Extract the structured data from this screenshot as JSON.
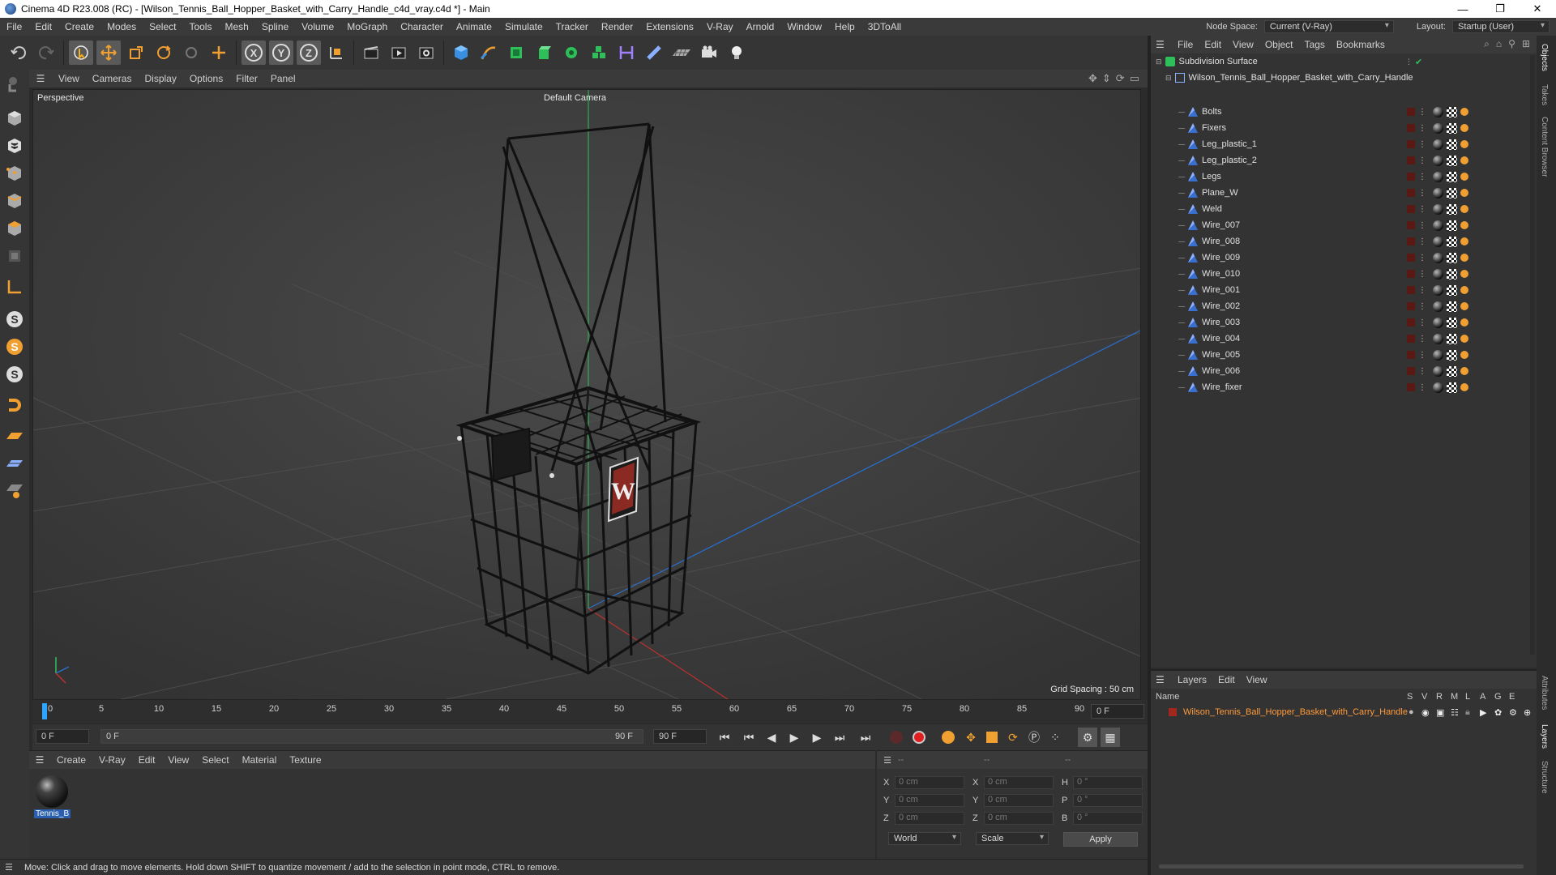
{
  "window": {
    "title": "Cinema 4D R23.008 (RC) - [Wilson_Tennis_Ball_Hopper_Basket_with_Carry_Handle_c4d_vray.c4d *] - Main",
    "controls": [
      "—",
      "❐",
      "✕"
    ]
  },
  "menubar": {
    "items": [
      "File",
      "Edit",
      "Create",
      "Modes",
      "Select",
      "Tools",
      "Mesh",
      "Spline",
      "Volume",
      "MoGraph",
      "Character",
      "Animate",
      "Simulate",
      "Tracker",
      "Render",
      "Extensions",
      "V-Ray",
      "Arnold",
      "Window",
      "Help",
      "3DToAll"
    ],
    "node_space_label": "Node Space:",
    "node_space_value": "Current (V-Ray)",
    "layout_label": "Layout:",
    "layout_value": "Startup (User)"
  },
  "viewport": {
    "menu": [
      "View",
      "Cameras",
      "Display",
      "Options",
      "Filter",
      "Panel"
    ],
    "projection": "Perspective",
    "camera": "Default Camera",
    "grid_spacing": "Grid Spacing : 50 cm"
  },
  "timeline": {
    "ticks": [
      "0",
      "5",
      "10",
      "15",
      "20",
      "25",
      "30",
      "35",
      "40",
      "45",
      "50",
      "55",
      "60",
      "65",
      "70",
      "75",
      "80",
      "85",
      "90"
    ],
    "current_frame": "0 F",
    "start_field": "0 F",
    "range_start": "0 F",
    "range_end": "90 F",
    "end_field": "90 F"
  },
  "material_manager": {
    "menu": [
      "Create",
      "V-Ray",
      "Edit",
      "View",
      "Select",
      "Material",
      "Texture"
    ],
    "materials": [
      {
        "name": "Tennis_B"
      }
    ]
  },
  "coordinates": {
    "header": [
      "--",
      "--",
      "--"
    ],
    "rows": [
      {
        "a": "X",
        "a_val": "0 cm",
        "b": "X",
        "b_val": "0 cm",
        "c": "H",
        "c_val": "0 °"
      },
      {
        "a": "Y",
        "a_val": "0 cm",
        "b": "Y",
        "b_val": "0 cm",
        "c": "P",
        "c_val": "0 °"
      },
      {
        "a": "Z",
        "a_val": "0 cm",
        "b": "Z",
        "b_val": "0 cm",
        "c": "B",
        "c_val": "0 °"
      }
    ],
    "space": "World",
    "mode": "Scale",
    "apply": "Apply"
  },
  "status": {
    "text": "Move: Click and drag to move elements. Hold down SHIFT to quantize movement / add to the selection in point mode, CTRL to remove."
  },
  "object_manager": {
    "menu": [
      "File",
      "Edit",
      "View",
      "Object",
      "Tags",
      "Bookmarks"
    ],
    "root": "Subdivision Surface",
    "group": "Wilson_Tennis_Ball_Hopper_Basket_with_Carry_Handle",
    "children": [
      "Bolts",
      "Fixers",
      "Leg_plastic_1",
      "Leg_plastic_2",
      "Legs",
      "Plane_W",
      "Weld",
      "Wire_007",
      "Wire_008",
      "Wire_009",
      "Wire_010",
      "Wire_001",
      "Wire_002",
      "Wire_003",
      "Wire_004",
      "Wire_005",
      "Wire_006",
      "Wire_fixer"
    ]
  },
  "layer_manager": {
    "menu": [
      "Layers",
      "Edit",
      "View"
    ],
    "columns": {
      "name": "Name",
      "flags": [
        "S",
        "V",
        "R",
        "M",
        "L",
        "A",
        "G",
        "E"
      ]
    },
    "layers": [
      {
        "name": "Wilson_Tennis_Ball_Hopper_Basket_with_Carry_Handle",
        "color": "#a0281c"
      }
    ]
  },
  "side_tabs": [
    "Objects",
    "Takes",
    "Content Browser",
    "Attributes",
    "Layers",
    "Structure"
  ],
  "colors": {
    "accent_blue": "#2ea5ff",
    "layer_orange": "#ff9a3a",
    "record_red": "#e02020"
  }
}
